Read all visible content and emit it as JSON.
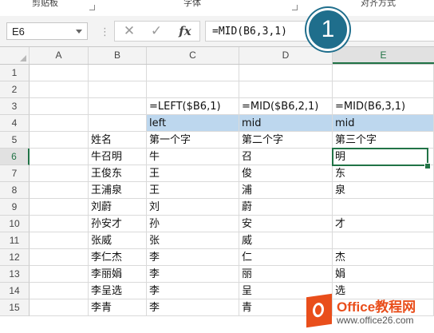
{
  "ribbon": {
    "groups": [
      "剪贴板",
      "字体",
      "对齐方式"
    ]
  },
  "formula_bar": {
    "name_box": "E6",
    "separator": "⋮",
    "cancel_icon": "✕",
    "enter_icon": "✓",
    "fx_label": "fx",
    "formula": "=MID(B6,3,1)"
  },
  "badge": {
    "number": "1"
  },
  "columns": [
    "A",
    "B",
    "C",
    "D",
    "E"
  ],
  "selected_column": "E",
  "selected_row": "6",
  "rows": [
    {
      "num": "1",
      "A": "",
      "B": "",
      "C": "",
      "D": "",
      "E": ""
    },
    {
      "num": "2",
      "A": "",
      "B": "",
      "C": "",
      "D": "",
      "E": ""
    },
    {
      "num": "3",
      "A": "",
      "B": "",
      "C": "=LEFT($B6,1)",
      "D": "=MID($B6,2,1)",
      "E": "=MID(B6,3,1)"
    },
    {
      "num": "4",
      "A": "",
      "B": "",
      "C": "left",
      "D": "mid",
      "E": "mid"
    },
    {
      "num": "5",
      "A": "",
      "B": "姓名",
      "C": "第一个字",
      "D": "第二个字",
      "E": "第三个字"
    },
    {
      "num": "6",
      "A": "",
      "B": "牛召明",
      "C": "牛",
      "D": "召",
      "E": "明"
    },
    {
      "num": "7",
      "A": "",
      "B": "王俊东",
      "C": "王",
      "D": "俊",
      "E": "东"
    },
    {
      "num": "8",
      "A": "",
      "B": "王浦泉",
      "C": "王",
      "D": "浦",
      "E": "泉"
    },
    {
      "num": "9",
      "A": "",
      "B": "刘蔚",
      "C": "刘",
      "D": "蔚",
      "E": ""
    },
    {
      "num": "10",
      "A": "",
      "B": "孙安才",
      "C": "孙",
      "D": "安",
      "E": "才"
    },
    {
      "num": "11",
      "A": "",
      "B": "张威",
      "C": "张",
      "D": "威",
      "E": ""
    },
    {
      "num": "12",
      "A": "",
      "B": "李仁杰",
      "C": "李",
      "D": "仁",
      "E": "杰"
    },
    {
      "num": "13",
      "A": "",
      "B": "李丽娟",
      "C": "李",
      "D": "丽",
      "E": "娟"
    },
    {
      "num": "14",
      "A": "",
      "B": "李呈选",
      "C": "李",
      "D": "呈",
      "E": "选"
    },
    {
      "num": "15",
      "A": "",
      "B": "李青",
      "C": "李",
      "D": "青",
      "E": ""
    }
  ],
  "watermark": {
    "title": "Office教程网",
    "url": "www.office26.com"
  },
  "colors": {
    "accent": "#217346",
    "highlight": "#bdd7ee",
    "badge": "#1f6e8c",
    "watermark": "#e94e1b"
  }
}
